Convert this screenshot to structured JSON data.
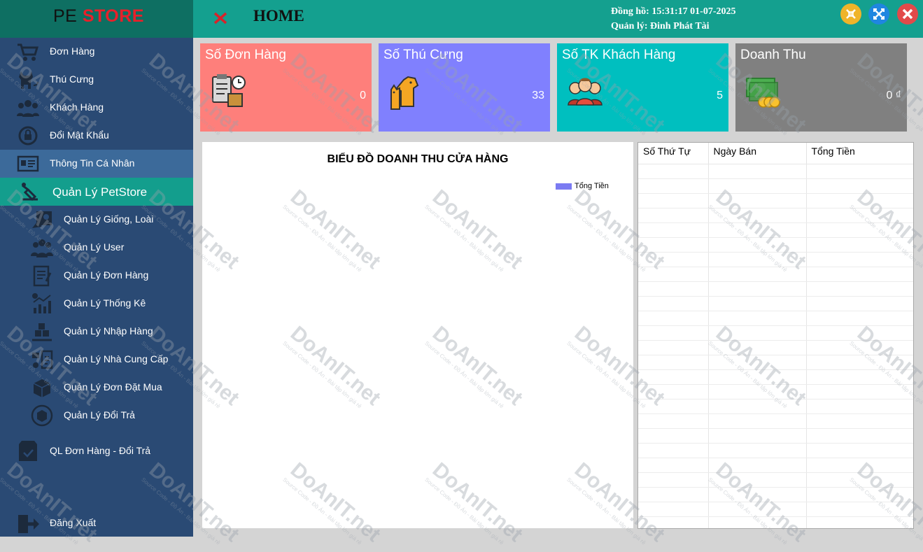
{
  "app": {
    "logo_part1": "PE",
    "logo_part2": "STORE"
  },
  "header": {
    "title": "HOME",
    "clock": "Đồng hồ: 15:31:17 01-07-2025",
    "manager": "Quản lý: Đinh Phát Tài"
  },
  "window_buttons": {
    "minimize_color": "#f0b429",
    "maximize_color": "#1f86e0",
    "close_color": "#e24a4a"
  },
  "sidebar": {
    "items": [
      {
        "label": "Đơn Hàng",
        "icon": "cart-icon"
      },
      {
        "label": "Thú Cưng",
        "icon": "pet-icon"
      },
      {
        "label": "Khách Hàng",
        "icon": "customers-icon"
      },
      {
        "label": "Đổi Mật Khẩu",
        "icon": "password-icon"
      },
      {
        "label": "Thông Tin Cá Nhân",
        "icon": "profile-card-icon"
      }
    ],
    "section": {
      "label": "Quản Lý PetStore",
      "icon": "manage-icon"
    },
    "sub_items": [
      {
        "label": "Quản Lý Giống, Loài",
        "icon": "breed-icon"
      },
      {
        "label": "Quản Lý User",
        "icon": "users-icon"
      },
      {
        "label": "Quản Lý Đơn Hàng",
        "icon": "orders-icon"
      },
      {
        "label": "Quản Lý Thống Kê",
        "icon": "stats-icon"
      },
      {
        "label": "Quản Lý Nhập Hàng",
        "icon": "import-icon"
      },
      {
        "label": "Quản Lý Nhà Cung Cấp",
        "icon": "supplier-icon"
      },
      {
        "label": "Quản Lý Đơn Đặt Mua",
        "icon": "purchase-order-icon"
      },
      {
        "label": "Quản Lý Đổi Trả",
        "icon": "return-icon"
      }
    ],
    "bottom_item": {
      "label": "QL Đơn Hàng - Đổi Trả",
      "icon": "order-return-icon"
    },
    "logout": {
      "label": "Đăng Xuất",
      "icon": "logout-icon"
    }
  },
  "cards": [
    {
      "title": "Số Đơn Hàng",
      "value": "0",
      "color": "#fe7f7b",
      "icon": "order-clipboard-icon"
    },
    {
      "title": "Số Thú Cưng",
      "value": "33",
      "color": "#8080fe",
      "icon": "dog-cat-icon"
    },
    {
      "title": "Số TK Khách Hàng",
      "value": "5",
      "color": "#00bfbf",
      "icon": "people-icon"
    },
    {
      "title": "Doanh Thu",
      "value": "0 ₫",
      "color": "#808080",
      "icon": "money-icon"
    }
  ],
  "chart_data": {
    "type": "bar",
    "title": "BIỂU ĐỒ DOANH THU CỬA HÀNG",
    "categories": [],
    "series": [
      {
        "name": "Tổng Tiền",
        "values": [],
        "color": "#7b7bf2"
      }
    ],
    "legend_position": "top-right"
  },
  "table": {
    "columns": [
      "Số Thứ Tự",
      "Ngày Bán",
      "Tổng Tiền"
    ],
    "rows": []
  },
  "watermark": {
    "brand": "DoAnIT.net",
    "tagline": "Source Code - Đồ Án - Bài tập lớn giá rẻ"
  }
}
